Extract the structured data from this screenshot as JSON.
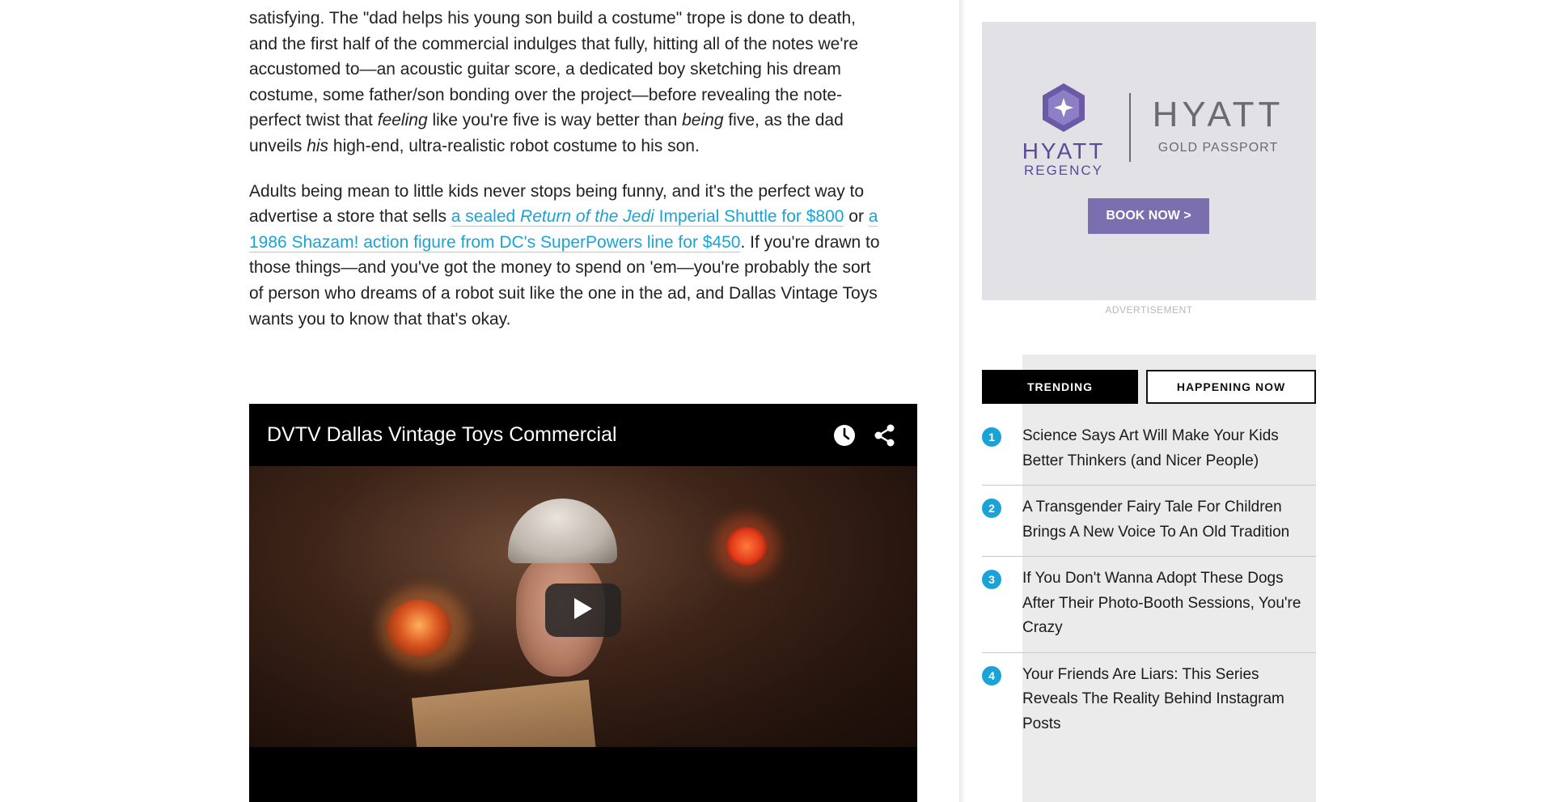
{
  "article": {
    "p1": [
      {
        "t": "satisfying. The \"dad helps his young son build a costume\" trope is done to death, and the first half of the commercial indulges that fully, hitting all of the notes we're accustomed to—an acoustic guitar score, a dedicated boy sketching his dream costume, some father/son bonding over the project—before revealing the note-perfect twist that "
      },
      {
        "t": "feeling",
        "em": true
      },
      {
        "t": " like you're five is way better than "
      },
      {
        "t": "being",
        "em": true
      },
      {
        "t": " five, as the dad unveils "
      },
      {
        "t": "his",
        "em": true
      },
      {
        "t": " high-end, ultra-realistic robot costume to his son."
      }
    ],
    "p2": [
      {
        "t": "Adults being mean to little kids never stops being funny, and it's the perfect way to advertise a store that sells "
      },
      {
        "t": "a sealed ",
        "link": true
      },
      {
        "t": "Return of the Jedi",
        "link": true,
        "em": true
      },
      {
        "t": " Imperial Shuttle for $800",
        "link": true
      },
      {
        "t": " or "
      },
      {
        "t": "a 1986 Shazam! action figure from DC's SuperPowers line for $450",
        "link": true
      },
      {
        "t": ". If you're drawn to those things—and you've got the money to spend on 'em—you're probably the sort of person who dreams of a robot suit like the one in the ad, and Dallas Vintage Toys wants you to know that that's okay."
      }
    ]
  },
  "video": {
    "title": "DVTV Dallas Vintage Toys Commercial",
    "watch_later_icon": "clock-icon",
    "share_icon": "share-icon",
    "play_icon": "play-icon"
  },
  "ad": {
    "brand_left_name": "HYATT",
    "brand_left_sub": "REGENCY",
    "brand_right_name": "HYATT",
    "brand_right_sub": "GOLD PASSPORT",
    "button_label": "BOOK NOW >",
    "label": "ADVERTISEMENT",
    "brand_color": "#5b4a98",
    "button_color": "#7b6fb0"
  },
  "tabs": [
    {
      "label": "TRENDING",
      "active": true
    },
    {
      "label": "HAPPENING NOW",
      "active": false
    }
  ],
  "trending": [
    {
      "num": "1",
      "title": "Science Says Art Will Make Your Kids Better Thinkers (and Nicer People)"
    },
    {
      "num": "2",
      "title": "A Transgender Fairy Tale For Children Brings A New Voice To An Old Tradition"
    },
    {
      "num": "3",
      "title": "If You Don't Wanna Adopt These Dogs After Their Photo-Booth Sessions, You're Crazy"
    },
    {
      "num": "4",
      "title": "Your Friends Are Liars: This Series Reveals The Reality Behind Instagram Posts"
    }
  ],
  "colors": {
    "link": "#1aa3d6",
    "badge": "#1aa3d6"
  }
}
